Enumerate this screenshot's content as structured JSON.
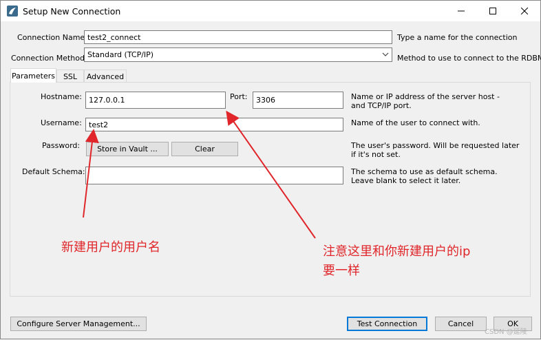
{
  "window": {
    "title": "Setup New Connection"
  },
  "connection_name": {
    "label": "Connection Name:",
    "value": "test2_connect",
    "hint": "Type a name for the connection"
  },
  "connection_method": {
    "label": "Connection Method:",
    "value": "Standard (TCP/IP)",
    "hint": "Method to use to connect to the RDBMS"
  },
  "tabs": [
    {
      "label": "Parameters",
      "active": true
    },
    {
      "label": "SSL",
      "active": false
    },
    {
      "label": "Advanced",
      "active": false
    }
  ],
  "params": {
    "hostname_label": "Hostname:",
    "hostname_value": "127.0.0.1",
    "port_label": "Port:",
    "port_value": "3306",
    "hostname_desc": "Name or IP address of the server host - and TCP/IP port.",
    "username_label": "Username:",
    "username_value": "test2",
    "username_desc": "Name of the user to connect with.",
    "password_label": "Password:",
    "store_vault_label": "Store in Vault ...",
    "clear_label": "Clear",
    "password_desc": "The user's password. Will be requested later if it's not set.",
    "schema_label": "Default Schema:",
    "schema_value": "",
    "schema_desc": "The schema to use as default schema. Leave blank to select it later."
  },
  "annotations": {
    "username_note": "新建用户的用户名",
    "ip_note_line1": "注意这里和你新建用户的ip",
    "ip_note_line2": "要一样",
    "color": "#e0262a"
  },
  "footer": {
    "configure_label": "Configure Server Management...",
    "test_label": "Test Connection",
    "cancel_label": "Cancel",
    "ok_label": "OK"
  },
  "watermark": "CSDN @延陵"
}
